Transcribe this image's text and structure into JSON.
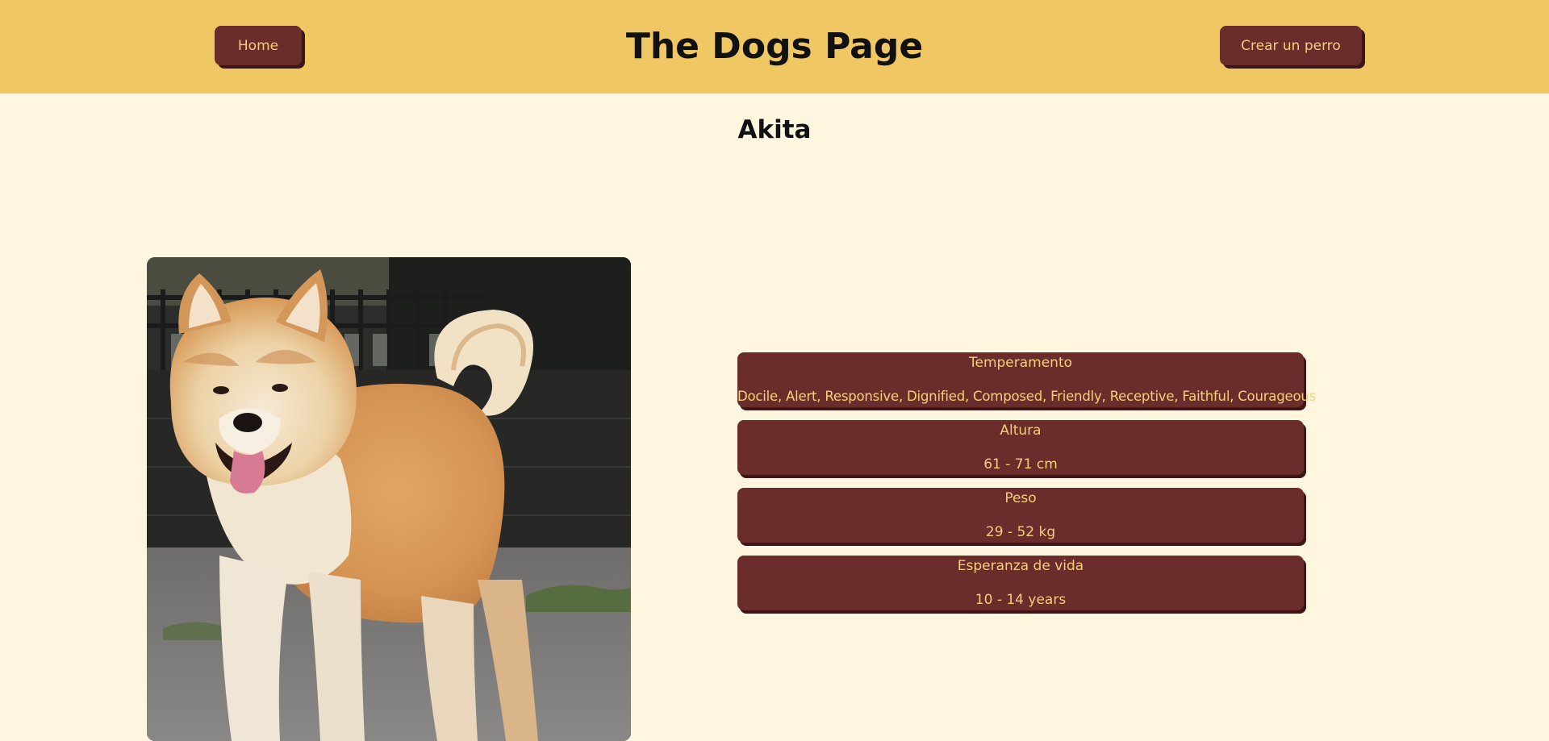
{
  "header": {
    "title": "The Dogs Page",
    "home_label": "Home",
    "create_label": "Crear un perro"
  },
  "dog": {
    "name": "Akita",
    "details": [
      {
        "label": "Temperamento",
        "value": "Docile, Alert, Responsive, Dignified, Composed, Friendly, Receptive, Faithful, Courageous"
      },
      {
        "label": "Altura",
        "value": "61 - 71 cm"
      },
      {
        "label": "Peso",
        "value": "29 - 52 kg"
      },
      {
        "label": "Esperanza de vida",
        "value": "10 - 14 years"
      }
    ]
  },
  "colors": {
    "header_bg": "#efc863",
    "page_bg": "#fff6e0",
    "accent": "#6b2c2c",
    "accent_text": "#f4cf77"
  }
}
